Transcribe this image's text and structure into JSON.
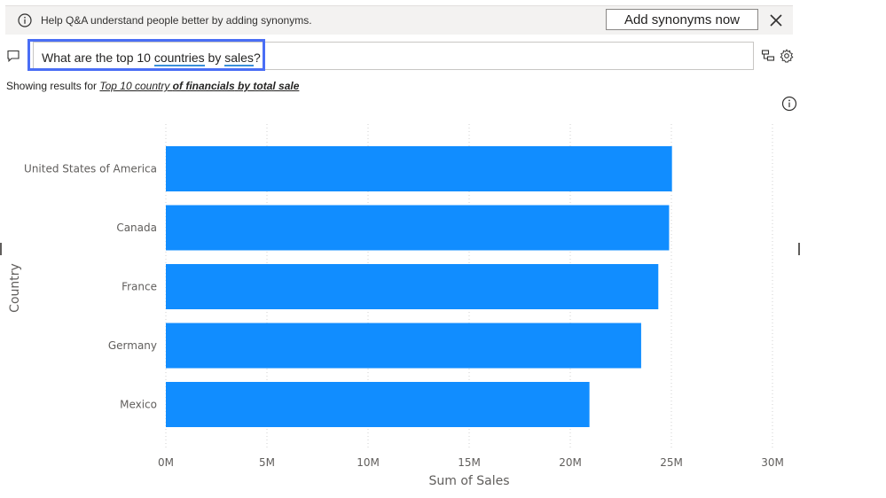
{
  "banner": {
    "text": "Help Q&A understand people better by adding synonyms.",
    "button_label": "Add synonyms now"
  },
  "question": {
    "segments": [
      {
        "text": "What are the top 10 ",
        "term": false
      },
      {
        "text": "countries",
        "term": true
      },
      {
        "text": " by ",
        "term": false
      },
      {
        "text": "sales",
        "term": true
      },
      {
        "text": "?",
        "term": false
      }
    ]
  },
  "showing": {
    "prefix": "Showing results for ",
    "link": [
      {
        "text": "Top 10 country ",
        "bold": false
      },
      {
        "text": "of financials",
        "bold": true
      },
      {
        "text": " ",
        "bold": false
      },
      {
        "text": "by total sale",
        "bold": true
      }
    ]
  },
  "colors": {
    "bar": "#118dff",
    "focus_border": "#4a6ef5",
    "term_underline": "#3a8fd9"
  },
  "chart_data": {
    "type": "bar",
    "orientation": "horizontal",
    "categories": [
      "United States of America",
      "Canada",
      "France",
      "Germany",
      "Mexico"
    ],
    "values": [
      25029830,
      24887655,
      24354172,
      23505341,
      20949352
    ],
    "xlabel": "Sum of Sales",
    "ylabel": "Country",
    "xlim": [
      0,
      30000000
    ],
    "ticks": [
      {
        "value": 0,
        "label": "0M"
      },
      {
        "value": 5000000,
        "label": "5M"
      },
      {
        "value": 10000000,
        "label": "10M"
      },
      {
        "value": 15000000,
        "label": "15M"
      },
      {
        "value": 20000000,
        "label": "20M"
      },
      {
        "value": 25000000,
        "label": "25M"
      },
      {
        "value": 30000000,
        "label": "30M"
      }
    ],
    "grid": true
  }
}
